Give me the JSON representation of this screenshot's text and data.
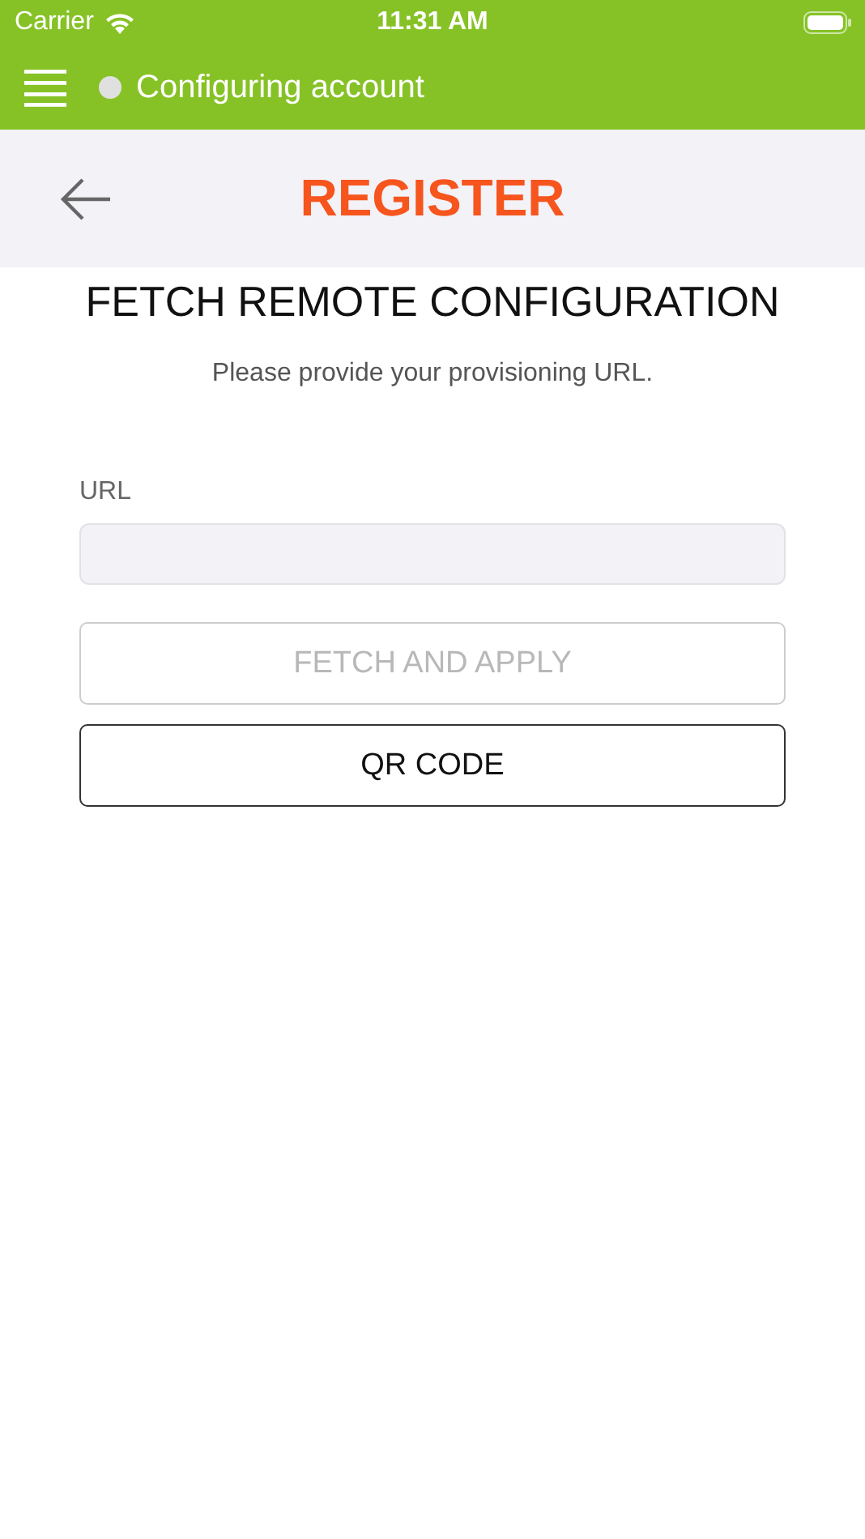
{
  "status_bar": {
    "carrier": "Carrier",
    "time": "11:31 AM"
  },
  "app_bar": {
    "status_text": "Configuring account"
  },
  "nav_bar": {
    "title": "REGISTER"
  },
  "heading": "FETCH REMOTE CONFIGURATION",
  "subtitle": "Please provide your provisioning URL.",
  "url_field": {
    "label": "URL"
  },
  "buttons": [
    {
      "label": "FETCH AND APPLY",
      "disabled": true
    },
    {
      "label": "QR CODE",
      "disabled": false
    }
  ]
}
